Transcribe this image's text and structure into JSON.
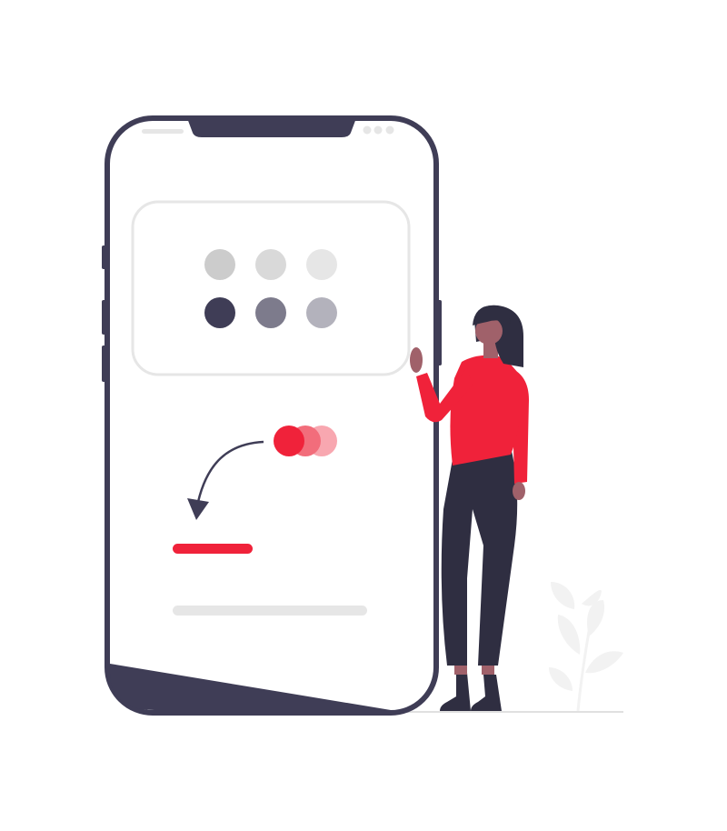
{
  "illustration": {
    "theme": "mobile color selection",
    "colors": {
      "frame": "#3f3d56",
      "accent": "#f0223a",
      "accent_light": "#f26d7b",
      "accent_lighter": "#f8a7b0",
      "screen": "#ffffff",
      "card_border": "#e6e6e6",
      "placeholder_bar": "#e6e6e6",
      "skin": "#a0616a",
      "hair": "#2f2e41",
      "pants": "#2f2e41",
      "plant": "#f2f2f2",
      "ground": "#e0e0e0"
    },
    "palette_swatches": [
      {
        "name": "grey-1",
        "color": "#cccccc"
      },
      {
        "name": "grey-2",
        "color": "#d9d9d9"
      },
      {
        "name": "grey-3",
        "color": "#e6e6e6"
      },
      {
        "name": "dark-1",
        "color": "#3f3d56"
      },
      {
        "name": "dark-2",
        "color": "#7d7b8c"
      },
      {
        "name": "dark-3",
        "color": "#b3b2bc"
      }
    ],
    "selected_color_dots": [
      {
        "name": "accent-dot-1",
        "color": "#f0223a"
      },
      {
        "name": "accent-dot-2",
        "color": "#f26d7b"
      },
      {
        "name": "accent-dot-3",
        "color": "#f8a7b0"
      }
    ],
    "icons": {
      "arrow": "curved-arrow-icon",
      "status": "status-dots-icon"
    }
  }
}
